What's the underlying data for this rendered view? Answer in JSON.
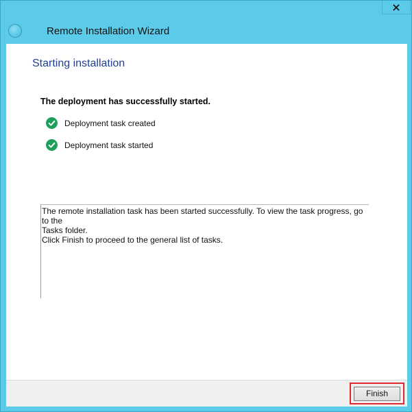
{
  "window": {
    "title": "Remote Installation Wizard",
    "accent_color": "#5ccbe9",
    "icon": "wizard-app-icon",
    "close_label": "close-icon"
  },
  "page": {
    "heading": "Starting installation",
    "heading_color": "#1f3f8f",
    "status_heading": "The deployment has successfully started.",
    "steps": [
      {
        "label": "Deployment task created",
        "status": "completed",
        "icon": "green-check-icon"
      },
      {
        "label": "Deployment task started",
        "status": "completed",
        "icon": "green-check-icon"
      }
    ],
    "message_lines": [
      "The remote installation task has been started successfully. To view the task progress, go to the",
      "Tasks folder.",
      "Click Finish to proceed to the general list of tasks."
    ]
  },
  "footer": {
    "finish_label": "Finish",
    "highlight_color": "#e0292e"
  }
}
